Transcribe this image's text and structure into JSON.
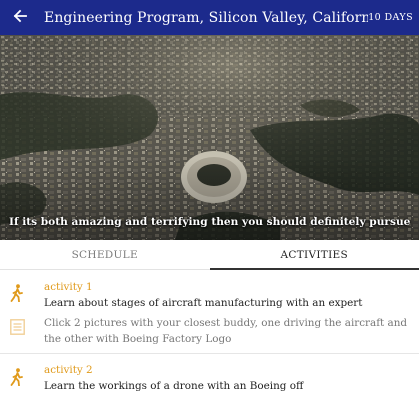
{
  "appbar": {
    "title": "Engineering Program, Silicon Valley, California",
    "badge": "10 DAYS",
    "color": "#1c2a8c"
  },
  "hero": {
    "caption": "If its both amazing and terrifying then you should definitely pursue"
  },
  "tabs": [
    {
      "label": "SCHEDULE",
      "selected": false
    },
    {
      "label": "ACTIVITIES",
      "selected": true
    }
  ],
  "activities": [
    {
      "icon": "walking-person-icon",
      "title": "activity 1",
      "description": "Learn about stages of aircraft manufacturing with an expert"
    },
    {
      "icon": "document-list-icon",
      "description": "Click 2 pictures with your closest buddy, one driving the aircraft and the other with Boeing Factory Logo"
    },
    {
      "icon": "walking-person-icon",
      "title": "activity 2",
      "description": "Learn the workings of a drone with an Boeing off"
    }
  ],
  "colors": {
    "accent_orange": "#e09a1b",
    "divider": "#e6e6e6"
  }
}
